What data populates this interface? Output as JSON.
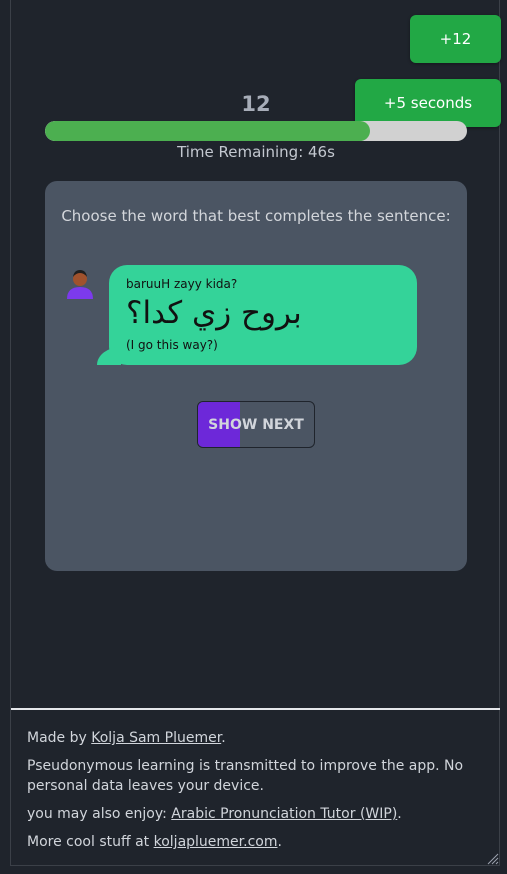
{
  "toasts": [
    {
      "text": "+12"
    },
    {
      "text": "+5 seconds"
    }
  ],
  "score": "12",
  "progress": {
    "fraction": 0.77
  },
  "timer": {
    "text": "Time Remaining: 46s"
  },
  "quiz": {
    "prompt": "Choose the word that best completes the sentence:",
    "message": {
      "transliteration": "baruuH zayy kida?",
      "arabic": "بروح زي كدا؟",
      "translation": "(I go this way?)"
    },
    "show_next_label": "SHOW NEXT",
    "show_next_fill_fraction": 0.36
  },
  "footer": {
    "made_by_prefix": "Made by ",
    "author": "Kolja Sam Pluemer",
    "period": ".",
    "privacy": "Pseudonymous learning is transmitted to improve the app. No personal data leaves your device.",
    "enjoy_prefix": "you may also enjoy: ",
    "enjoy_link": "Arabic Pronunciation Tutor (WIP)",
    "more_prefix": "More cool stuff at ",
    "more_link": "koljapluemer.com"
  },
  "colors": {
    "background": "#1f242c",
    "card": "#4b5563",
    "bubble": "#34d399",
    "toast": "#22a845",
    "progress_fill": "#4caf50",
    "button_fill": "#6d28d9"
  }
}
